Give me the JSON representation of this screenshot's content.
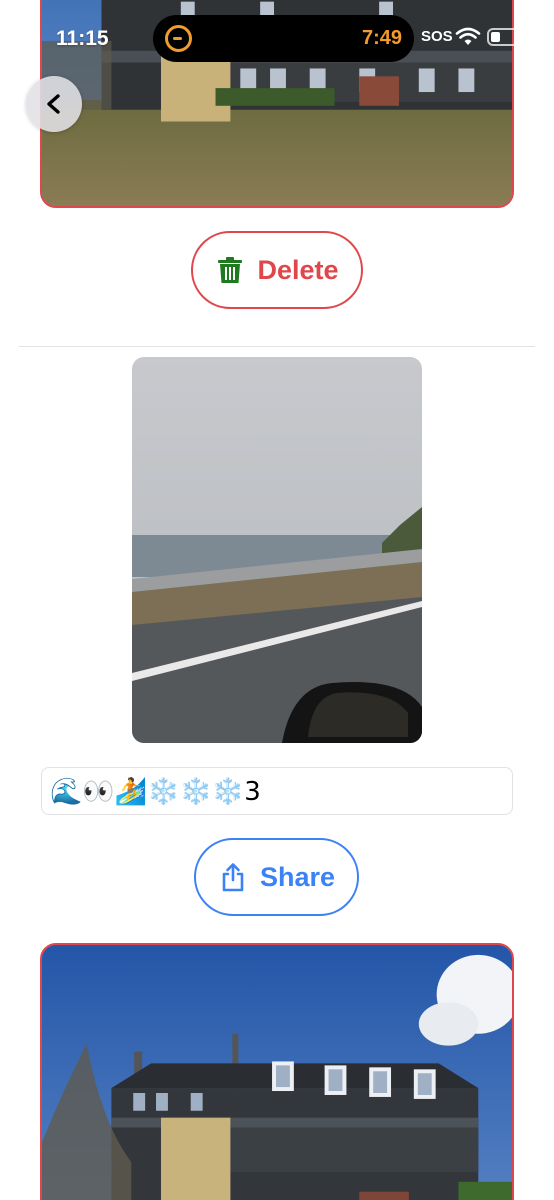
{
  "status_bar": {
    "time": "11:15",
    "timer": "7:49",
    "carrier": "SOS",
    "icons": [
      "timer-icon",
      "wifi-icon",
      "battery-icon"
    ]
  },
  "navigation": {
    "back_icon": "chevron-left-icon"
  },
  "post_1": {
    "photo": "house-photo",
    "delete_label": "Delete",
    "delete_icon": "trash-icon"
  },
  "post_2": {
    "photo": "ocean-road-photo",
    "caption": "🌊👀🏄❄️❄️❄️3",
    "share_label": "Share",
    "share_icon": "share-icon"
  },
  "post_3": {
    "photo": "house-photo"
  },
  "colors": {
    "delete_accent": "#e0474c",
    "trash_icon": "#1f7a1f",
    "share_accent": "#3b82f6",
    "timer_accent": "#f29c2b"
  }
}
